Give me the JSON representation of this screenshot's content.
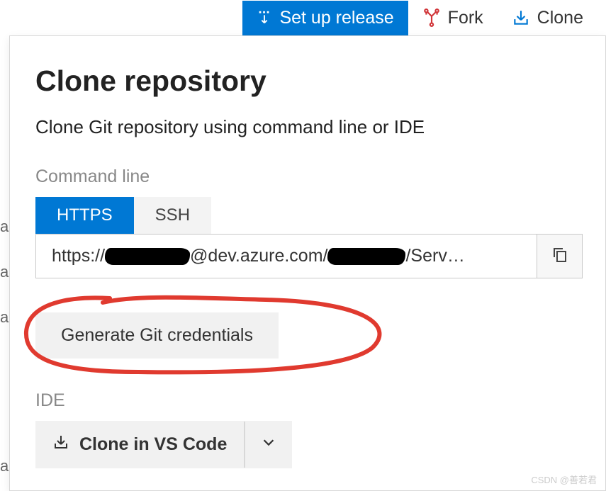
{
  "toolbar": {
    "setup_release": "Set up release",
    "fork": "Fork",
    "clone": "Clone"
  },
  "panel": {
    "title": "Clone repository",
    "subtitle": "Clone Git repository using command line or IDE",
    "command_line_label": "Command line",
    "tabs": {
      "https": "HTTPS",
      "ssh": "SSH"
    },
    "url_prefix": "https://",
    "url_mid": "@dev.azure.com/",
    "url_suffix": "/Serv…",
    "generate_credentials": "Generate Git credentials",
    "ide_label": "IDE",
    "clone_vscode": "Clone in VS Code"
  },
  "watermark": "CSDN @善若君"
}
